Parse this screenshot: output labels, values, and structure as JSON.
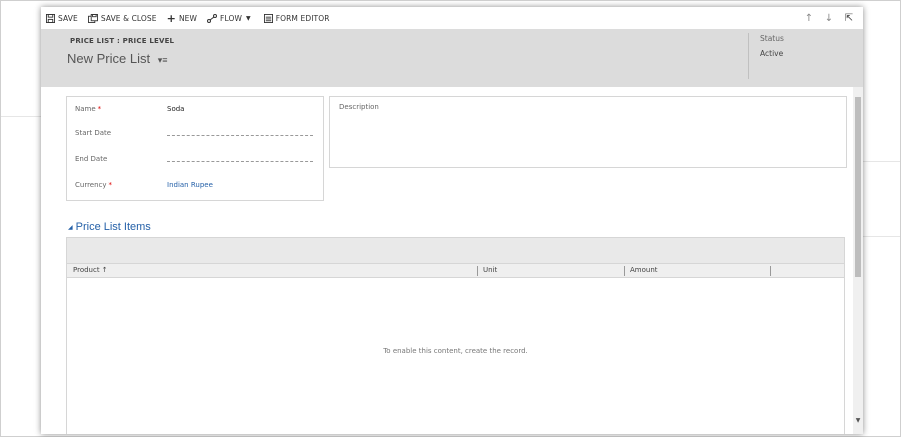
{
  "toolbar": {
    "save_label": "SAVE",
    "save_close_label": "SAVE & CLOSE",
    "new_label": "NEW",
    "flow_label": "FLOW",
    "form_editor_label": "FORM EDITOR"
  },
  "header": {
    "entity_label": "PRICE LIST : PRICE LEVEL",
    "record_title": "New Price List",
    "status_label": "Status",
    "status_value": "Active"
  },
  "fields": {
    "name": {
      "label": "Name",
      "value": "Soda",
      "required": true
    },
    "start_date": {
      "label": "Start Date",
      "value": ""
    },
    "end_date": {
      "label": "End Date",
      "value": ""
    },
    "currency": {
      "label": "Currency",
      "value": "Indian Rupee",
      "required": true
    }
  },
  "description": {
    "label": "Description"
  },
  "section": {
    "title": "Price List Items",
    "columns": [
      "Product ↑",
      "Unit",
      "Amount"
    ],
    "empty_message": "To enable this content, create the record."
  },
  "colors": {
    "link": "#2460a8",
    "header_bg": "#dcdcdc",
    "required": "#dd0000"
  },
  "icons": [
    "save-icon",
    "save-close-icon",
    "plus-icon",
    "flow-icon",
    "chevron-down-icon",
    "form-editor-icon",
    "arrow-up-icon",
    "arrow-down-icon",
    "expand-icon",
    "list-menu-icon",
    "collapse-caret-icon"
  ]
}
